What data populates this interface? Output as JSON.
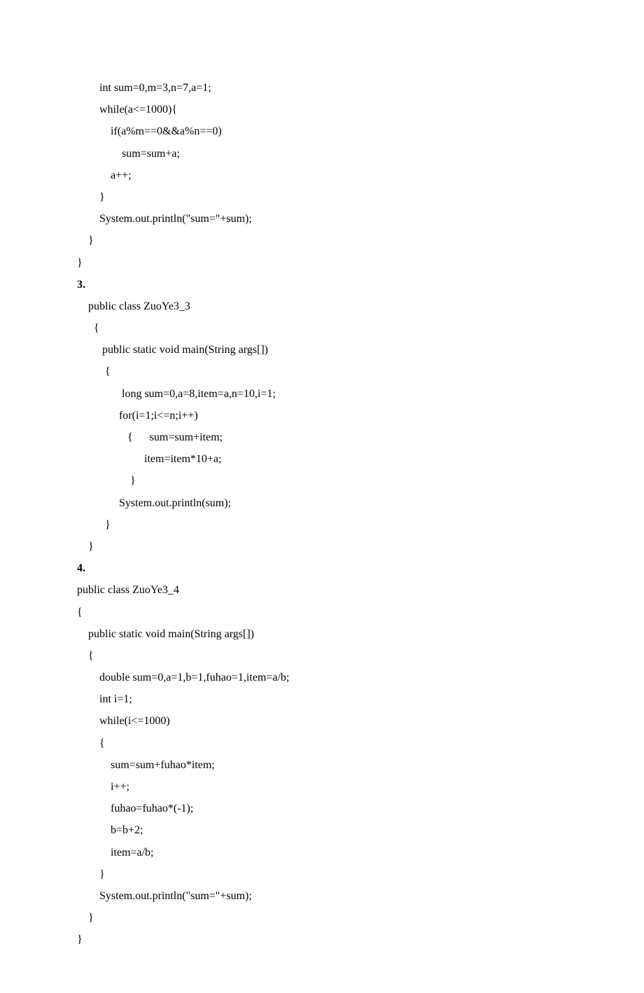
{
  "lines": [
    {
      "t": "        int sum=0,m=3,n=7,a=1;"
    },
    {
      "t": "        while(a<=1000){"
    },
    {
      "t": "            if(a%m==0&&a%n==0)"
    },
    {
      "t": "                sum=sum+a;"
    },
    {
      "t": "            a++;"
    },
    {
      "t": "        }"
    },
    {
      "t": "        System.out.println(\"sum=\"+sum);"
    },
    {
      "t": "    }"
    },
    {
      "t": "}"
    },
    {
      "t": "3.",
      "b": true
    },
    {
      "t": "    public class ZuoYe3_3"
    },
    {
      "t": "      {"
    },
    {
      "t": "         public static void main(String args[])"
    },
    {
      "t": "          {"
    },
    {
      "t": "                long sum=0,a=8,item=a,n=10,i=1;"
    },
    {
      "t": "               for(i=1;i<=n;i++)"
    },
    {
      "t": "                  {      sum=sum+item;"
    },
    {
      "t": "                        item=item*10+a;"
    },
    {
      "t": "                   }"
    },
    {
      "t": "               System.out.println(sum);"
    },
    {
      "t": "          }"
    },
    {
      "t": "    }"
    },
    {
      "t": "4.",
      "b": true
    },
    {
      "t": "public class ZuoYe3_4"
    },
    {
      "t": "{"
    },
    {
      "t": "    public static void main(String args[])"
    },
    {
      "t": "    {"
    },
    {
      "t": "        double sum=0,a=1,b=1,fuhao=1,item=a/b;"
    },
    {
      "t": "        int i=1;"
    },
    {
      "t": "        while(i<=1000)"
    },
    {
      "t": "        {"
    },
    {
      "t": "            sum=sum+fuhao*item;"
    },
    {
      "t": "            i++;"
    },
    {
      "t": "            fuhao=fuhao*(-1);"
    },
    {
      "t": "            b=b+2;"
    },
    {
      "t": "            item=a/b;"
    },
    {
      "t": "        }"
    },
    {
      "t": "        System.out.println(\"sum=\"+sum);"
    },
    {
      "t": "    }"
    },
    {
      "t": "}"
    }
  ]
}
